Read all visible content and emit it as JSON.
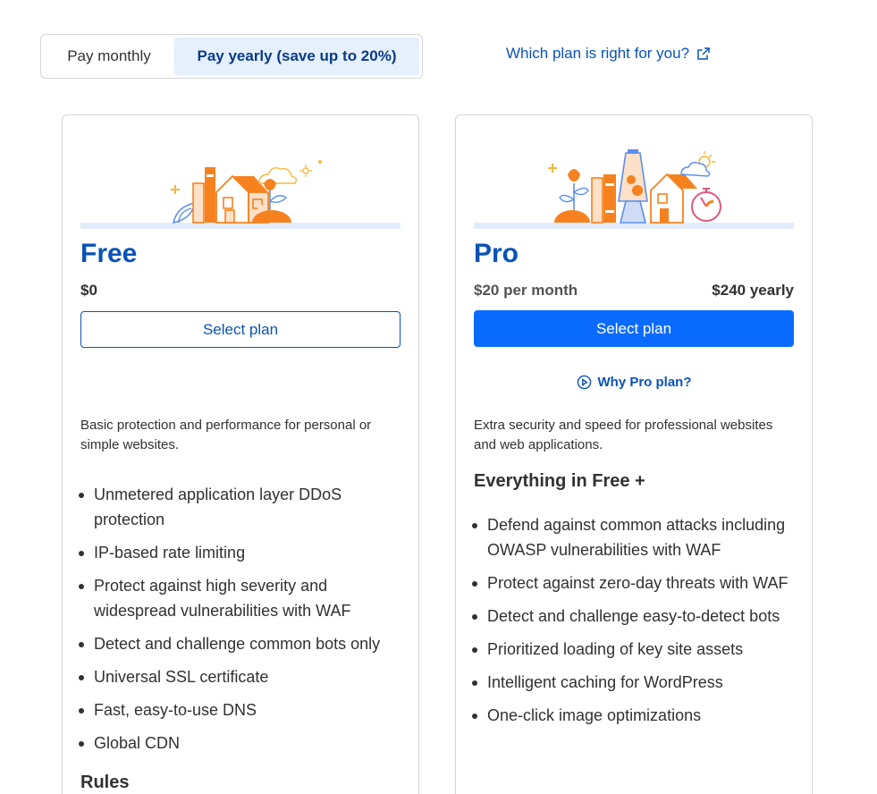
{
  "billing_toggle": {
    "monthly_label": "Pay monthly",
    "yearly_label": "Pay yearly (save up to 20%)",
    "selected": "yearly"
  },
  "help_link": {
    "label": "Which plan is right for you?",
    "icon": "external-link-icon"
  },
  "plans": [
    {
      "name": "Free",
      "price": "$0",
      "button_label": "Select plan",
      "description": "Basic protection and performance for personal or simple websites.",
      "features": [
        "Unmetered application layer DDoS protection",
        "IP-based rate limiting",
        "Protect against high severity and widespread vulnerabilities with WAF",
        "Detect and challenge common bots only",
        "Universal SSL certificate",
        "Fast, easy-to-use DNS",
        "Global CDN"
      ],
      "next_section_heading": "Rules"
    },
    {
      "name": "Pro",
      "price_monthly": "$20 per month",
      "price_yearly": "$240 yearly",
      "button_label": "Select plan",
      "why_link": "Why Pro plan?",
      "description": "Extra security and speed for professional websites and web applications.",
      "features_heading": "Everything in Free +",
      "features": [
        "Defend against common attacks including OWASP vulnerabilities with WAF",
        "Protect against zero-day threats with WAF",
        "Detect and challenge easy-to-detect bots",
        "Prioritized loading of key site assets",
        "Intelligent caching for WordPress",
        "One-click image optimizations"
      ]
    }
  ],
  "colors": {
    "brand_blue": "#0a52b8",
    "button_blue": "#0a6cff",
    "toggle_selected_bg": "#e6f0fc",
    "illustration_orange": "#f6821f"
  }
}
